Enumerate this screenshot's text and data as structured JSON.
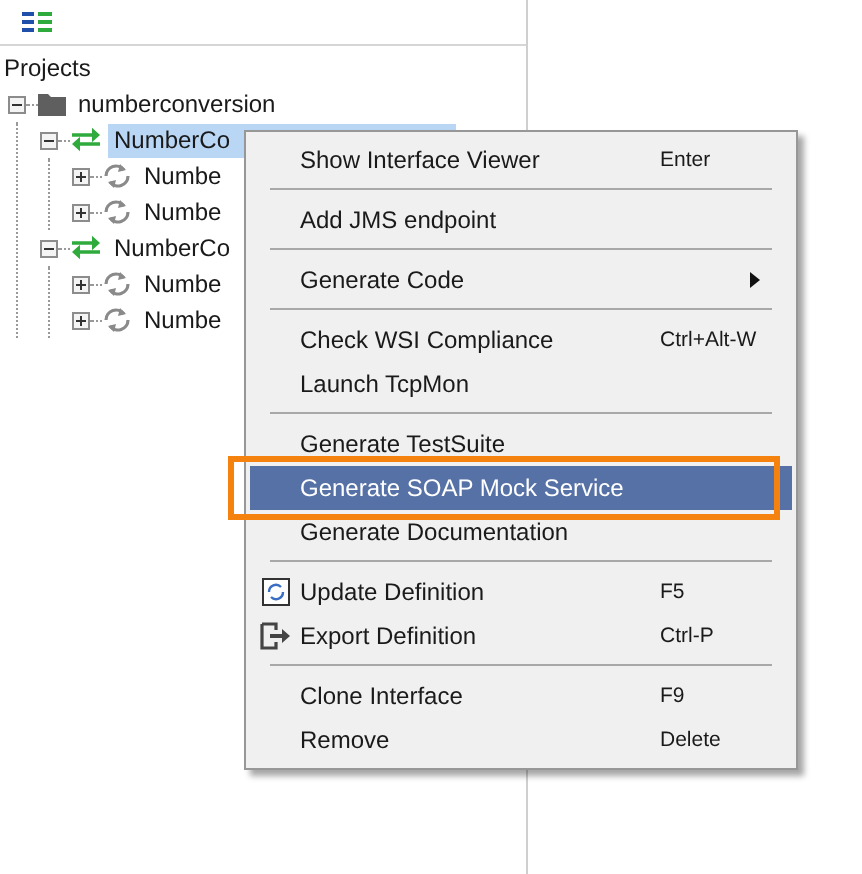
{
  "tree_title": "Projects",
  "tree": [
    {
      "kind": "project",
      "label": "numberconversion",
      "expanded": true,
      "selected": false,
      "children": [
        {
          "kind": "interface",
          "label": "NumberCo",
          "expanded": true,
          "selected": true,
          "children": [
            {
              "kind": "operation",
              "label": "Numbe",
              "expanded": false,
              "selected": false
            },
            {
              "kind": "operation",
              "label": "Numbe",
              "expanded": false,
              "selected": false
            }
          ]
        },
        {
          "kind": "interface",
          "label": "NumberCo",
          "expanded": true,
          "selected": false,
          "children": [
            {
              "kind": "operation",
              "label": "Numbe",
              "expanded": false,
              "selected": false
            },
            {
              "kind": "operation",
              "label": "Numbe",
              "expanded": false,
              "selected": false
            }
          ]
        }
      ]
    }
  ],
  "context_menu": [
    {
      "kind": "item",
      "label": "Show Interface Viewer",
      "shortcut": "Enter",
      "selected": false
    },
    {
      "kind": "separator"
    },
    {
      "kind": "item",
      "label": "Add JMS endpoint",
      "selected": false
    },
    {
      "kind": "separator"
    },
    {
      "kind": "item",
      "label": "Generate Code",
      "submenu": true,
      "selected": false
    },
    {
      "kind": "separator"
    },
    {
      "kind": "item",
      "label": "Check WSI Compliance",
      "shortcut": "Ctrl+Alt-W",
      "selected": false
    },
    {
      "kind": "item",
      "label": "Launch TcpMon",
      "selected": false
    },
    {
      "kind": "separator"
    },
    {
      "kind": "item",
      "label": "Generate TestSuite",
      "selected": false
    },
    {
      "kind": "item",
      "label": "Generate SOAP Mock Service",
      "selected": true
    },
    {
      "kind": "item",
      "label": "Generate Documentation",
      "selected": false
    },
    {
      "kind": "separator"
    },
    {
      "kind": "icon_item",
      "label": "Update Definition",
      "shortcut": "F5",
      "selected": false
    },
    {
      "kind": "icon_item",
      "label": "Export Definition",
      "shortcut": "Ctrl-P",
      "selected": false
    },
    {
      "kind": "separator"
    },
    {
      "kind": "item",
      "label": "Clone Interface",
      "shortcut": "F9",
      "selected": false
    },
    {
      "kind": "item",
      "label": "Remove",
      "shortcut": "Delete",
      "selected": false
    }
  ]
}
